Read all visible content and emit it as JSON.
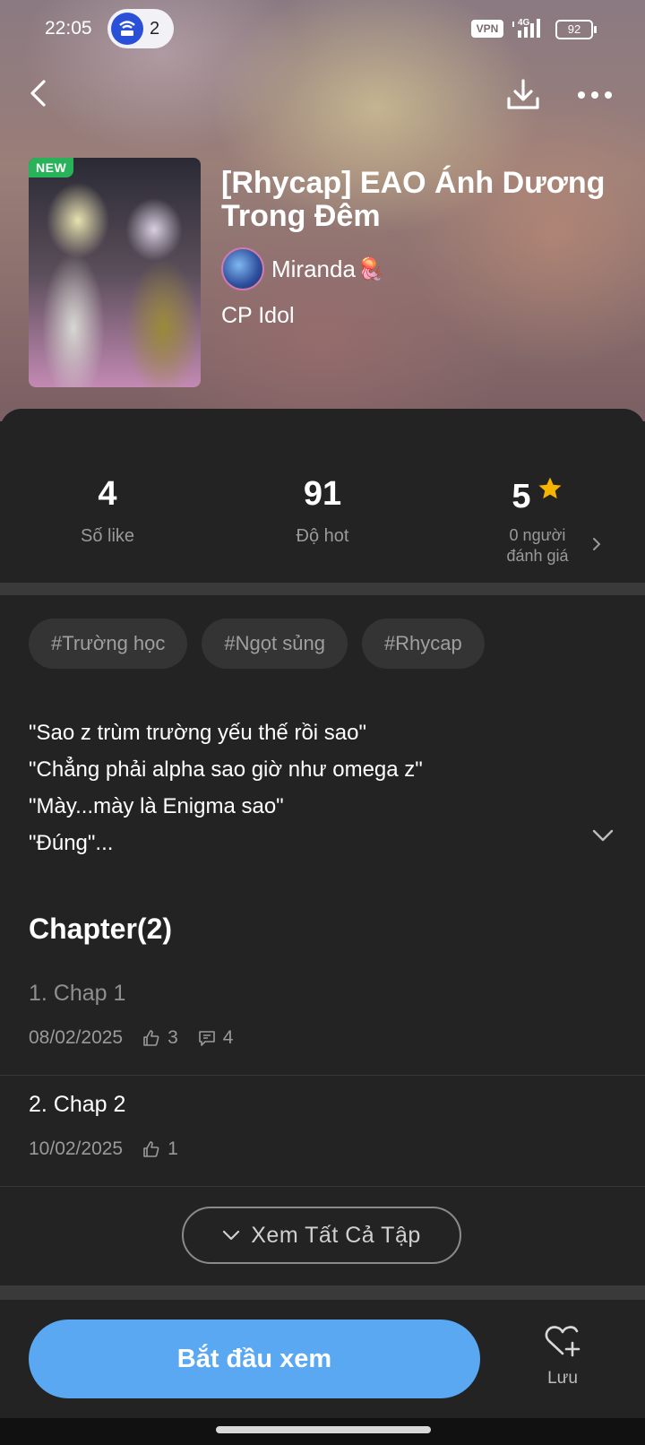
{
  "status_bar": {
    "time": "22:05",
    "hotspot_count": "2",
    "vpn": "VPN",
    "network": "4G",
    "battery": "92"
  },
  "header": {
    "back_icon": "back-arrow-icon",
    "download_icon": "download-icon",
    "more_icon": "more-dots-icon"
  },
  "book": {
    "badge": "NEW",
    "title": "[Rhycap] EAO Ánh Dương Trong Đêm",
    "author": "Miranda",
    "author_emoji": "🪼",
    "category": "CP Idol"
  },
  "stats": {
    "likes": {
      "value": "4",
      "label": "Số like"
    },
    "hot": {
      "value": "91",
      "label": "Độ hot"
    },
    "rating": {
      "value": "5",
      "label_line1": "0 người",
      "label_line2": "đánh giá"
    }
  },
  "tags": [
    "#Trường học",
    "#Ngọt sủng",
    "#Rhycap"
  ],
  "description": {
    "line1": "\"Sao z trùm trường yếu thế rồi sao\"",
    "line2": "\"Chẳng phải alpha sao giờ như omega z\"",
    "line3": "\"Mày...mày là Enigma sao\"",
    "line4": "\"Đúng\"..."
  },
  "chapters_section": {
    "title": "Chapter(2)",
    "items": [
      {
        "title": "1. Chap 1",
        "date": "08/02/2025",
        "likes": "3",
        "comments": "4"
      },
      {
        "title": "2. Chap 2",
        "date": "10/02/2025",
        "likes": "1"
      }
    ],
    "view_all": "Xem Tất Cả Tập"
  },
  "actions": {
    "start": "Bắt đầu xem",
    "save": "Lưu"
  },
  "colors": {
    "accent": "#5aa8f2",
    "star": "#f5b400",
    "new_badge": "#28b35a",
    "panel": "#232323"
  }
}
